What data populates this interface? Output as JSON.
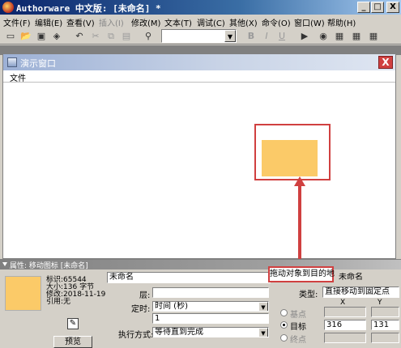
{
  "app": {
    "title": "Authorware 中文版: [未命名] *"
  },
  "window_buttons": {
    "minimize": "_",
    "maximize": "□",
    "close": "X"
  },
  "menubar": {
    "items": [
      {
        "label": "文件(F)",
        "enabled": true
      },
      {
        "label": "编辑(E)",
        "enabled": true
      },
      {
        "label": "查看(V)",
        "enabled": true
      },
      {
        "label": "插入(I)",
        "enabled": false
      },
      {
        "label": "修改(M)",
        "enabled": true
      },
      {
        "label": "文本(T)",
        "enabled": true
      },
      {
        "label": "调试(C)",
        "enabled": true
      },
      {
        "label": "其他(X)",
        "enabled": true
      },
      {
        "label": "命令(O)",
        "enabled": true
      },
      {
        "label": "窗口(W)",
        "enabled": true
      },
      {
        "label": "帮助(H)",
        "enabled": true
      }
    ]
  },
  "toolbar": {
    "icons": [
      "new-file-icon",
      "open-icon",
      "save-all-icon",
      "import-icon",
      "undo-icon",
      "cut-icon",
      "copy-icon",
      "paste-icon",
      "find-icon"
    ],
    "bold": "B",
    "italic": "I",
    "underline": "U",
    "font_value": ""
  },
  "presentation_window": {
    "title": "演示窗口",
    "close": "X",
    "menu": "文件"
  },
  "properties": {
    "title": "属性: 移动图标 [未命名]",
    "info": [
      "标识:65544",
      "大小:136 字节",
      "修改:2018-11-19",
      "引用:无"
    ],
    "preview_label": "预览",
    "name_value": "未命名",
    "layer_label": "层:",
    "layer_value": "",
    "timing_label": "定时:",
    "timing_value": "时间 (秒)",
    "timing_amount": "1",
    "exec_label": "执行方式:",
    "exec_value": "等待直到完成",
    "right_name": "未命名",
    "type_label": "类型:",
    "type_value": "直接移动到固定点",
    "radio_base": "基点",
    "radio_target": "目标",
    "radio_end": "终点",
    "col_x": "X",
    "col_y": "Y",
    "target_x": "316",
    "target_y": "131"
  },
  "annotation": {
    "callout": "拖动对象到目的地"
  }
}
